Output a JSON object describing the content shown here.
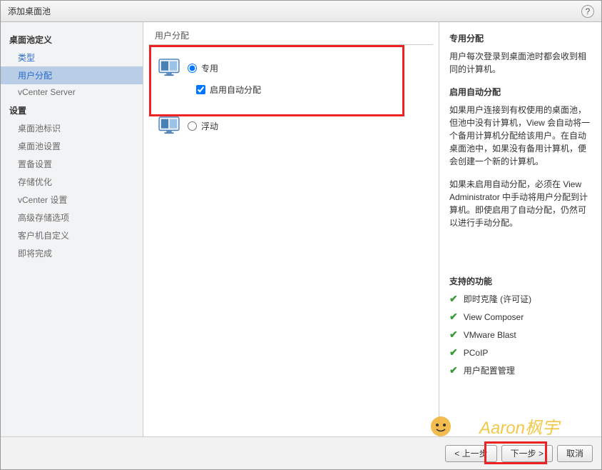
{
  "title": "添加桌面池",
  "sidebar": {
    "section1": "桌面池定义",
    "items1": [
      {
        "label": "类型",
        "link": true
      },
      {
        "label": "用户分配",
        "active": true
      },
      {
        "label": "vCenter Server"
      }
    ],
    "section2": "设置",
    "items2": [
      {
        "label": "桌面池标识"
      },
      {
        "label": "桌面池设置"
      },
      {
        "label": "置备设置"
      },
      {
        "label": "存储优化"
      },
      {
        "label": "vCenter 设置"
      },
      {
        "label": "高级存储选项"
      },
      {
        "label": "客户机自定义"
      },
      {
        "label": "即将完成"
      }
    ]
  },
  "center": {
    "heading": "用户分配",
    "opt1": "专用",
    "opt1check": "启用自动分配",
    "opt2": "浮动"
  },
  "right": {
    "h1": "专用分配",
    "p1": "用户每次登录到桌面池时都会收到相同的计算机。",
    "h2": "启用自动分配",
    "p2": "如果用户连接到有权使用的桌面池，但池中没有计算机，View 会自动将一个备用计算机分配给该用户。在自动桌面池中，如果没有备用计算机，便会创建一个新的计算机。",
    "p3": "如果未启用自动分配，必须在 View Administrator 中手动将用户分配到计算机。即使启用了自动分配，仍然可以进行手动分配。",
    "h3": "支持的功能",
    "features": [
      "即时克隆 (许可证)",
      "View Composer",
      "VMware Blast",
      "PCoIP",
      "用户配置管理"
    ]
  },
  "footer": {
    "back": "< 上一步",
    "next": "下一步 >",
    "cancel": "取消"
  },
  "watermark": "Aaron枫宇"
}
